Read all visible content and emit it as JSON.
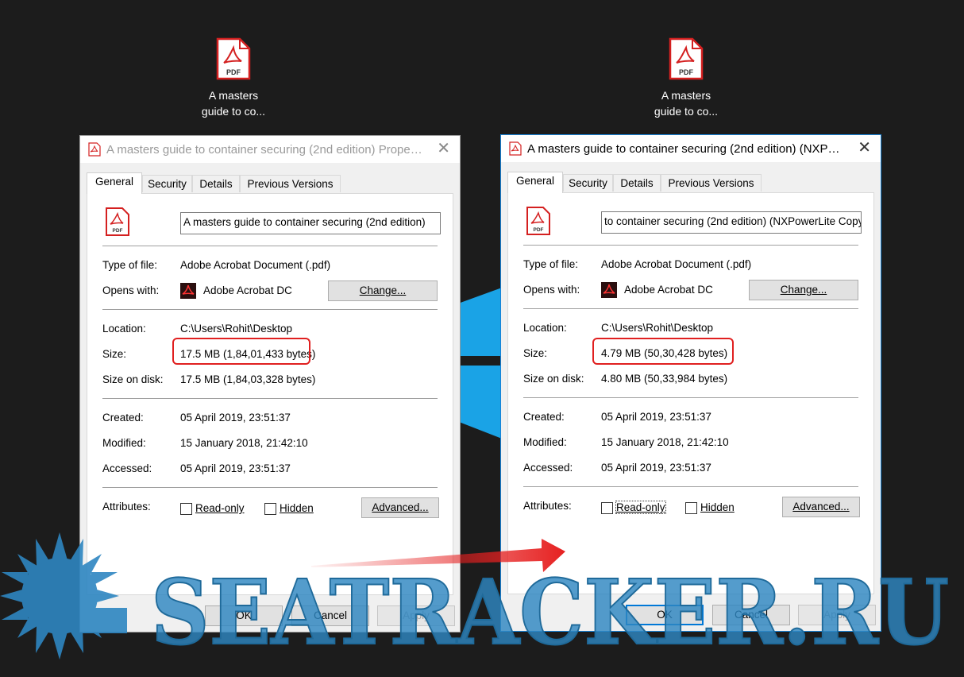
{
  "desktop": {
    "icons": [
      {
        "line1": "A masters",
        "line2": "guide to co..."
      },
      {
        "line1": "A masters",
        "line2": "guide to co..."
      }
    ]
  },
  "icon_text": {
    "pdf": "PDF"
  },
  "dialogs": [
    {
      "title": "A masters guide to container securing (2nd edition) Propert...",
      "tabs": [
        "General",
        "Security",
        "Details",
        "Previous Versions"
      ],
      "file_name": "A masters guide to container securing (2nd edition)",
      "type_label": "Type of file:",
      "type_value": "Adobe Acrobat Document (.pdf)",
      "opens_label": "Opens with:",
      "opens_value": "Adobe Acrobat DC",
      "change_button": "Change...",
      "location_label": "Location:",
      "location_value": "C:\\Users\\Rohit\\Desktop",
      "size_label": "Size:",
      "size_value": "17.5 MB (1,84,01,433 bytes)",
      "size_disk_label": "Size on disk:",
      "size_disk_value": "17.5 MB (1,84,03,328 bytes)",
      "created_label": "Created:",
      "created_value": "05 April 2019, 23:51:37",
      "modified_label": "Modified:",
      "modified_value": "15 January 2018, 21:42:10",
      "accessed_label": "Accessed:",
      "accessed_value": "05 April 2019, 23:51:37",
      "attributes_label": "Attributes:",
      "readonly_label": "Read-only",
      "hidden_label": "Hidden",
      "advanced_button": "Advanced...",
      "ok_button": "OK",
      "cancel_button": "Cancel",
      "apply_button": "Apply",
      "readonly_checked": false,
      "hidden_checked": false
    },
    {
      "title": "A masters guide to container securing (2nd edition) (NXPow...",
      "tabs": [
        "General",
        "Security",
        "Details",
        "Previous Versions"
      ],
      "file_name": "to container securing (2nd edition) (NXPowerLite Copy)",
      "type_label": "Type of file:",
      "type_value": "Adobe Acrobat Document (.pdf)",
      "opens_label": "Opens with:",
      "opens_value": "Adobe Acrobat DC",
      "change_button": "Change...",
      "location_label": "Location:",
      "location_value": "C:\\Users\\Rohit\\Desktop",
      "size_label": "Size:",
      "size_value": "4.79 MB (50,30,428 bytes)",
      "size_disk_label": "Size on disk:",
      "size_disk_value": "4.80 MB (50,33,984 bytes)",
      "created_label": "Created:",
      "created_value": "05 April 2019, 23:51:37",
      "modified_label": "Modified:",
      "modified_value": "15 January 2018, 21:42:10",
      "accessed_label": "Accessed:",
      "accessed_value": "05 April 2019, 23:51:37",
      "attributes_label": "Attributes:",
      "readonly_label": "Read-only",
      "hidden_label": "Hidden",
      "advanced_button": "Advanced...",
      "ok_button": "OK",
      "cancel_button": "Cancel",
      "apply_button": "Apply",
      "readonly_checked": false,
      "hidden_checked": false
    }
  ],
  "watermark": {
    "text": "SEATRACKER.RU"
  },
  "colors": {
    "highlight": "#e02020",
    "arrow": "#e62020",
    "windows_logo": "#1aa3e6",
    "watermark": "#2e86c1",
    "pdf_red": "#d42020"
  }
}
